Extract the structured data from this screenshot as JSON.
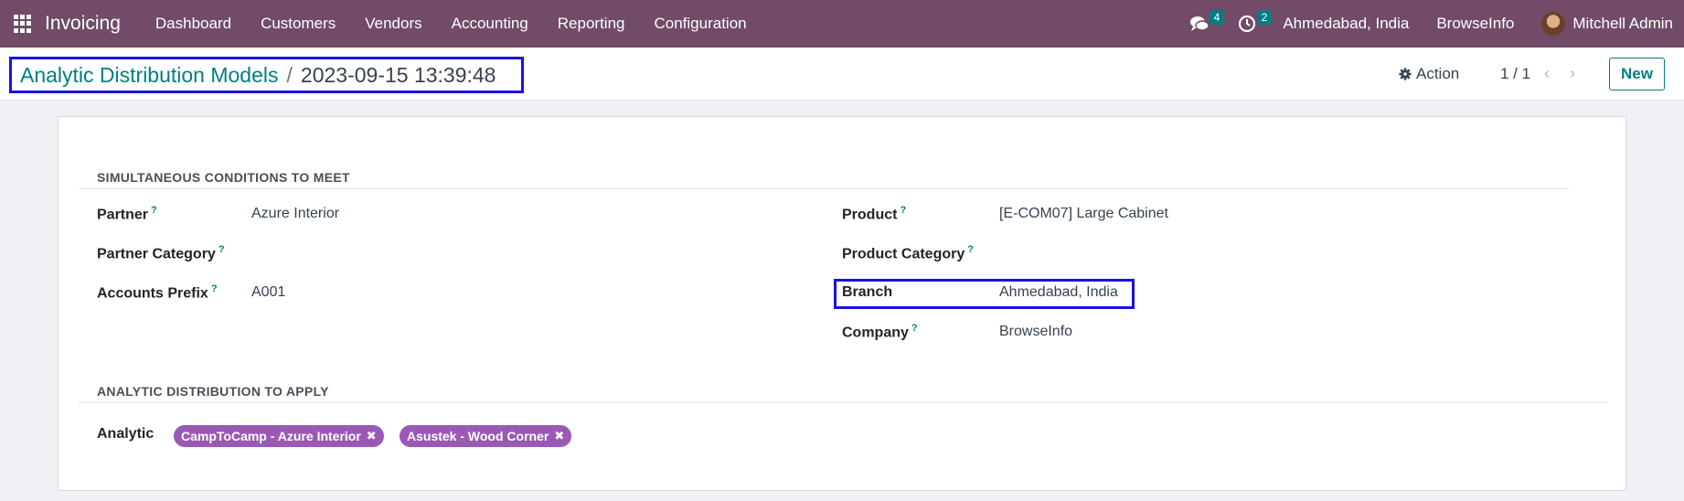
{
  "navbar": {
    "app_name": "Invoicing",
    "menu": [
      "Dashboard",
      "Customers",
      "Vendors",
      "Accounting",
      "Reporting",
      "Configuration"
    ],
    "messages_count": "4",
    "activities_count": "2",
    "branch": "Ahmedabad, India",
    "company": "BrowseInfo",
    "user": "Mitchell Admin"
  },
  "control_panel": {
    "breadcrumb_parent": "Analytic Distribution Models",
    "breadcrumb_separator": "/",
    "breadcrumb_current": "2023-09-15 13:39:48",
    "action_label": "Action",
    "pager": "1 / 1",
    "new_label": "New"
  },
  "form": {
    "section1_title": "SIMULTANEOUS CONDITIONS TO MEET",
    "partner_label": "Partner",
    "partner_value": "Azure Interior",
    "partner_category_label": "Partner Category",
    "accounts_prefix_label": "Accounts Prefix",
    "accounts_prefix_value": "A001",
    "product_label": "Product",
    "product_value": "[E-COM07] Large Cabinet",
    "product_category_label": "Product Category",
    "branch_label": "Branch",
    "branch_value": "Ahmedabad, India",
    "company_label": "Company",
    "company_value": "BrowseInfo",
    "help_mark": "?",
    "section2_title": "ANALYTIC DISTRIBUTION TO APPLY",
    "analytic_label": "Analytic",
    "analytic_tags": [
      "CampToCamp - Azure Interior",
      "Asustek - Wood Corner"
    ],
    "tag_remove": "✖"
  },
  "colors": {
    "navbar_bg": "#714b67",
    "accent": "#017e84",
    "tag_bg": "#9b59b6",
    "highlight_border": "#1a12e0"
  }
}
